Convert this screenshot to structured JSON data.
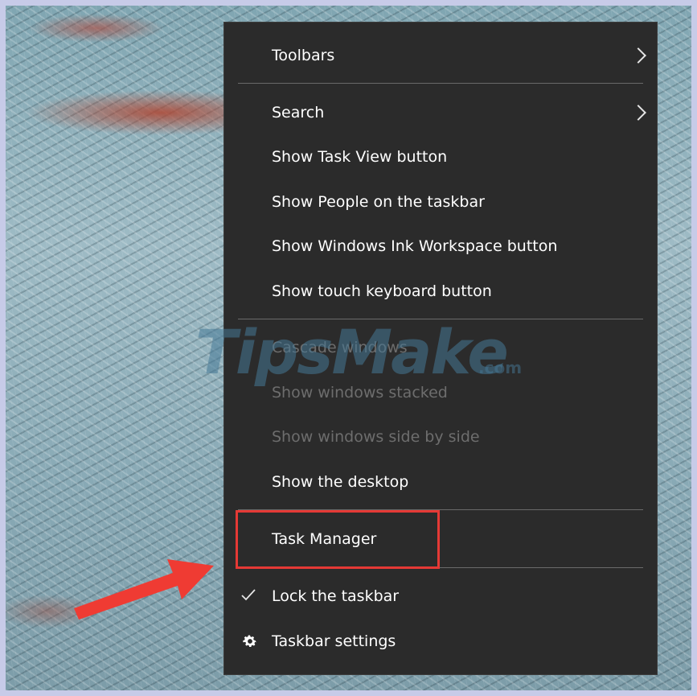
{
  "menu": {
    "items": [
      {
        "label": "Toolbars",
        "submenu": true
      },
      {
        "label": "Search",
        "submenu": true
      },
      {
        "label": "Show Task View button"
      },
      {
        "label": "Show People on the taskbar"
      },
      {
        "label": "Show Windows Ink Workspace button"
      },
      {
        "label": "Show touch keyboard button"
      },
      {
        "label": "Cascade windows",
        "disabled": true
      },
      {
        "label": "Show windows stacked",
        "disabled": true
      },
      {
        "label": "Show windows side by side",
        "disabled": true
      },
      {
        "label": "Show the desktop"
      },
      {
        "label": "Task Manager",
        "highlighted": true
      },
      {
        "label": "Lock the taskbar",
        "checked": true,
        "icon": "checkmark-icon"
      },
      {
        "label": "Taskbar settings",
        "icon": "gear-icon"
      }
    ]
  },
  "watermark": {
    "main": "TipsMake",
    "sub": ".com"
  },
  "colors": {
    "menu_background": "#2b2b2b",
    "menu_text": "#ffffff",
    "disabled_text": "#6d6d6d",
    "highlight": "#e53935",
    "frame": "#c7cbe8"
  }
}
